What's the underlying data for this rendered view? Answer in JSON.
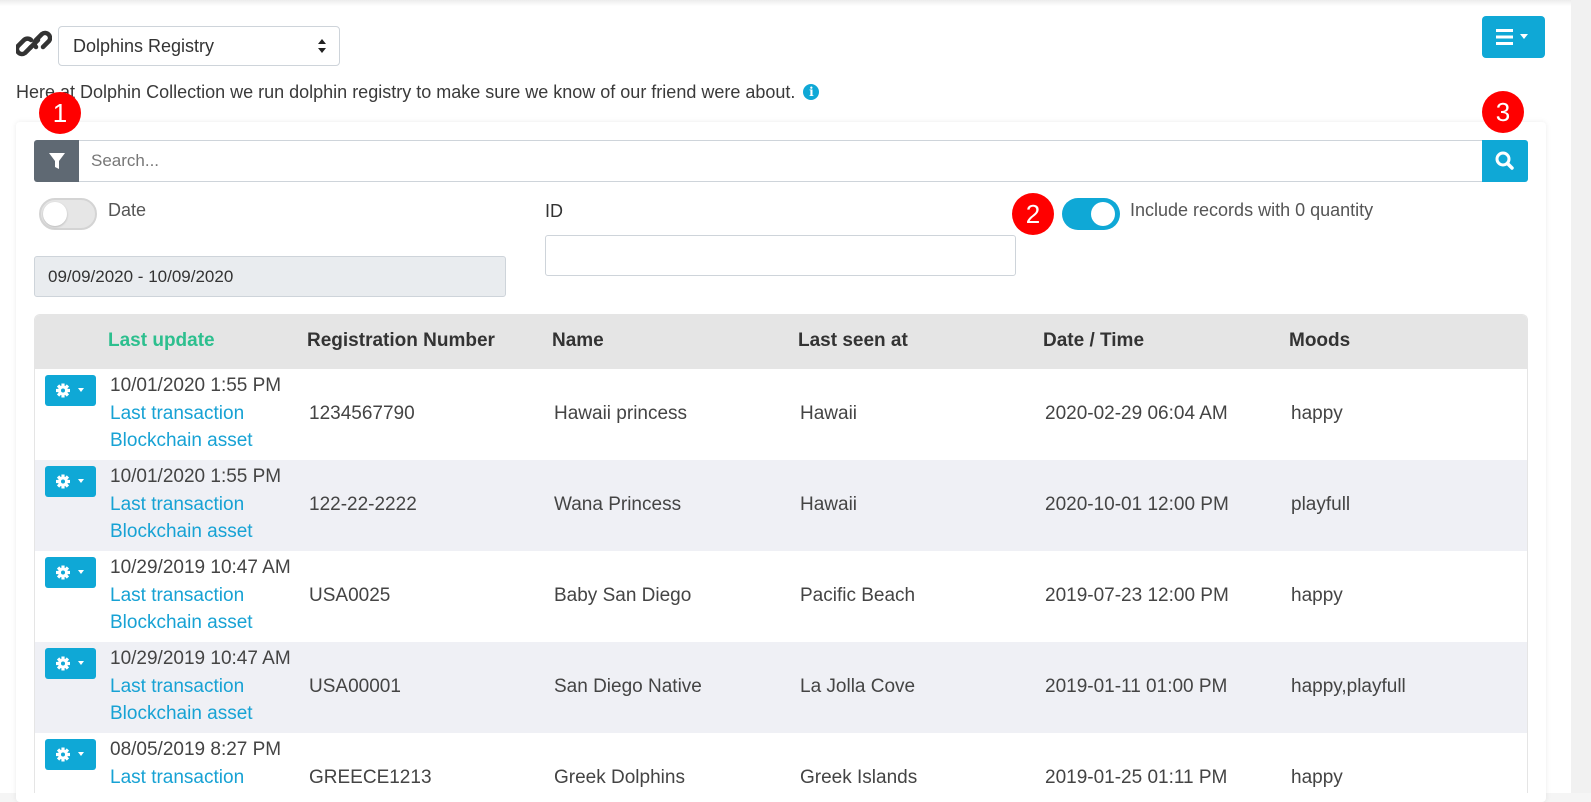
{
  "header": {
    "registry_select": "Dolphins Registry",
    "description": "Here at Dolphin Collection we run dolphin registry to make sure we know of our friend were about.",
    "accent_color": "#0fa8d6"
  },
  "search": {
    "placeholder": "Search..."
  },
  "badges": [
    "1",
    "2",
    "3"
  ],
  "filters": {
    "date_label": "Date",
    "date_enabled": false,
    "date_range": "09/09/2020 - 10/09/2020",
    "id_label": "ID",
    "id_value": "",
    "include_zero_label": "Include records with 0 quantity",
    "include_zero_enabled": true
  },
  "table": {
    "columns": [
      "Last update",
      "Registration Number",
      "Name",
      "Last seen at",
      "Date / Time",
      "Moods"
    ],
    "sorted_column": "Last update",
    "link_labels": {
      "transaction": "Last transaction",
      "blockchain": "Blockchain asset"
    },
    "rows": [
      {
        "updated": "10/01/2020 1:55 PM",
        "reg": "1234567790",
        "name": "Hawaii princess",
        "seen": "Hawaii",
        "datetime": "2020-02-29 06:04 AM",
        "moods": "happy"
      },
      {
        "updated": "10/01/2020 1:55 PM",
        "reg": "122-22-2222",
        "name": "Wana Princess",
        "seen": "Hawaii",
        "datetime": "2020-10-01 12:00 PM",
        "moods": "playfull"
      },
      {
        "updated": "10/29/2019 10:47 AM",
        "reg": "USA0025",
        "name": "Baby San Diego",
        "seen": "Pacific Beach",
        "datetime": "2019-07-23 12:00 PM",
        "moods": "happy"
      },
      {
        "updated": "10/29/2019 10:47 AM",
        "reg": "USA00001",
        "name": "San Diego Native",
        "seen": "La Jolla Cove",
        "datetime": "2019-01-11 01:00 PM",
        "moods": "happy,playfull"
      },
      {
        "updated": "08/05/2019 8:27 PM",
        "reg": "GREECE1213",
        "name": "Greek Dolphins",
        "seen": "Greek Islands",
        "datetime": "2019-01-25 01:11 PM",
        "moods": "happy"
      }
    ]
  }
}
